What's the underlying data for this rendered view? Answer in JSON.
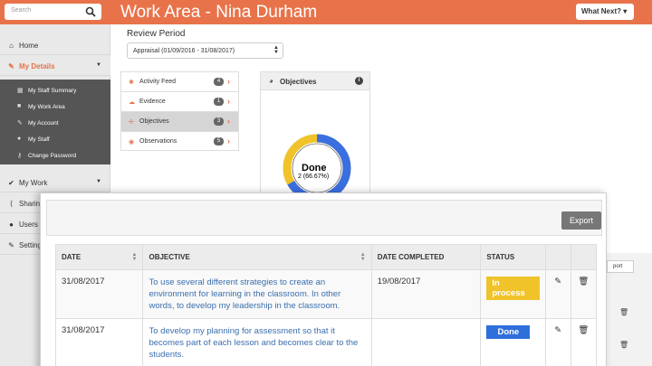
{
  "search": {
    "placeholder": "Search"
  },
  "header": {
    "title": "Work Area - Nina Durham",
    "what_next": "What Next? ▾"
  },
  "sidebar": {
    "items": [
      {
        "label": "Home",
        "icon": "home-icon"
      },
      {
        "label": "My Details",
        "icon": "pencil-icon"
      },
      {
        "label": "My Work",
        "icon": "check-icon"
      },
      {
        "label": "Sharin",
        "icon": "share-icon"
      },
      {
        "label": "Users",
        "icon": "users-icon"
      },
      {
        "label": "Setting",
        "icon": "wrench-icon"
      }
    ],
    "submenu": [
      {
        "label": "My Staff Summary",
        "icon": "grid-icon"
      },
      {
        "label": "My Work Area",
        "icon": "briefcase-icon"
      },
      {
        "label": "My Account",
        "icon": "wrench-icon"
      },
      {
        "label": "My Staff",
        "icon": "users-icon"
      },
      {
        "label": "Change Password",
        "icon": "key-icon"
      }
    ]
  },
  "review": {
    "label": "Review Period",
    "selected": "Appraisal (01/09/2016 - 31/08/2017)"
  },
  "tabs": [
    {
      "label": "Activity Feed",
      "count": "4",
      "icon": "feed-icon"
    },
    {
      "label": "Evidence",
      "count": "1",
      "icon": "upload-icon"
    },
    {
      "label": "Objectives",
      "count": "3",
      "icon": "target-icon"
    },
    {
      "label": "Observations",
      "count": "5",
      "icon": "eye-icon"
    }
  ],
  "objectives_panel": {
    "title": "Objectives",
    "donut_main": "Done",
    "donut_sub": "2 (66.67%)",
    "done_fraction": 0.6667,
    "colors": {
      "done": "#3b6fe0",
      "in_process": "#f0c32a"
    }
  },
  "bg_table": {
    "export_label": "port"
  },
  "modal": {
    "export_label": "Export",
    "columns": [
      "DATE",
      "OBJECTIVE",
      "DATE COMPLETED",
      "STATUS"
    ],
    "rows": [
      {
        "date": "31/08/2017",
        "objective": "To use several different strategies to create an environment for learning in the classroom. In other words, to develop my leadership in the classroom.",
        "completed": "19/08/2017",
        "status": "In process"
      },
      {
        "date": "31/08/2017",
        "objective": "To develop my planning for assessment so that it becomes part of each lesson and becomes clear to the students.",
        "completed": "",
        "status": "Done"
      }
    ]
  },
  "colors": {
    "brand": "#e8734a",
    "link": "#3b6fae"
  }
}
